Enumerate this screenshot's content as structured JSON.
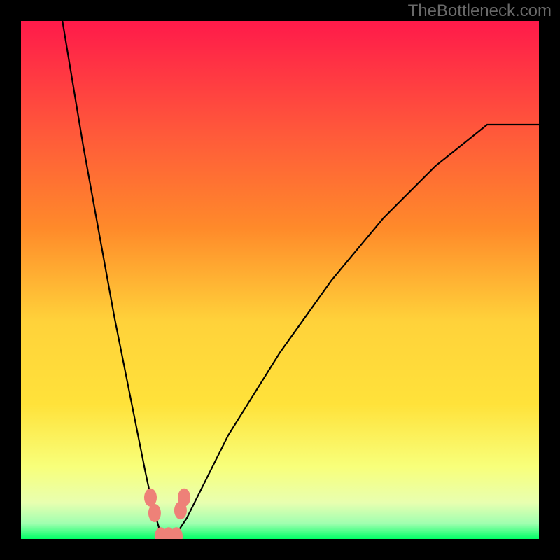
{
  "watermark": "TheBottleneck.com",
  "chart_data": {
    "type": "line",
    "title": "",
    "xlabel": "",
    "ylabel": "",
    "xlim": [
      0,
      100
    ],
    "ylim": [
      0,
      100
    ],
    "background_gradient": {
      "top_color": "#ff1a4a",
      "upper_mid_color": "#ff8a2a",
      "mid_color": "#ffe23a",
      "lower_mid_color": "#f8ff7a",
      "near_bottom_color": "#e8ffb0",
      "bottom_color": "#00ff66"
    },
    "series": [
      {
        "name": "bottleneck-curve",
        "color": "#000000",
        "x": [
          8,
          10,
          12,
          14,
          16,
          18,
          20,
          22,
          24,
          25.5,
          27,
          28,
          29,
          30,
          32,
          35,
          40,
          45,
          50,
          55,
          60,
          65,
          70,
          75,
          80,
          85,
          90,
          95,
          100
        ],
        "y": [
          100,
          88,
          76,
          65,
          54,
          43,
          33,
          23,
          13,
          6,
          1,
          0,
          0,
          1,
          4,
          10,
          20,
          28,
          36,
          43,
          50,
          56,
          62,
          67,
          72,
          76,
          80,
          80,
          80
        ]
      }
    ],
    "markers": [
      {
        "name": "marker-left-upper",
        "cx": 25.0,
        "cy": 8.0,
        "color": "#ee8178"
      },
      {
        "name": "marker-left-lower",
        "cx": 25.8,
        "cy": 5.0,
        "color": "#ee8178"
      },
      {
        "name": "marker-right-upper",
        "cx": 31.5,
        "cy": 8.0,
        "color": "#ee8178"
      },
      {
        "name": "marker-right-lower",
        "cx": 30.8,
        "cy": 5.5,
        "color": "#ee8178"
      },
      {
        "name": "marker-bottom-left",
        "cx": 27.0,
        "cy": 0.5,
        "color": "#ee8178"
      },
      {
        "name": "marker-bottom-mid",
        "cx": 28.5,
        "cy": 0.5,
        "color": "#ee8178"
      },
      {
        "name": "marker-bottom-right",
        "cx": 30.0,
        "cy": 0.5,
        "color": "#ee8178"
      }
    ]
  }
}
